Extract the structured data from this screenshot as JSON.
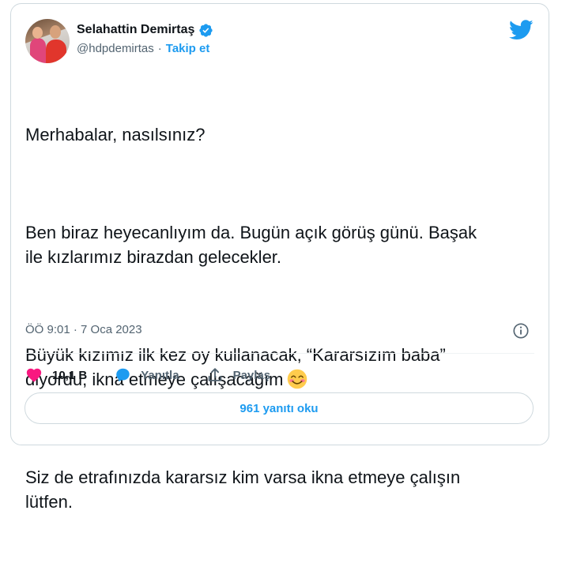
{
  "author": {
    "name": "Selahattin Demirtaş",
    "handle": "@hdpdemirtas",
    "separator": "·",
    "follow_label": "Takip et"
  },
  "tweet": {
    "paragraphs": [
      "Merhabalar, nasılsınız?",
      "Ben biraz heyecanlıyım da. Bugün açık görüş günü. Başak\nile kızlarımız birazdan gelecekler.",
      "Büyük kızımız ilk kez oy kullanacak, “Kararsızım baba”\ndiyordu, ikna etmeye çalışacağım",
      "Siz de etrafınızda kararsız kim varsa ikna etmeye çalışın\nlütfen."
    ],
    "emoji": "smiling-face-with-smiling-eyes",
    "timestamp": "ÖÖ 9:01 · 7 Oca 2023"
  },
  "actions": {
    "like_count": "10,1 B",
    "reply_label": "Yanıtla",
    "share_label": "Paylaş"
  },
  "footer": {
    "read_replies_label": "961 yanıtı oku"
  },
  "colors": {
    "brand_blue": "#1d9bf0",
    "like_pink": "#f91880",
    "text_secondary": "#536471",
    "border": "#cfd9de"
  }
}
